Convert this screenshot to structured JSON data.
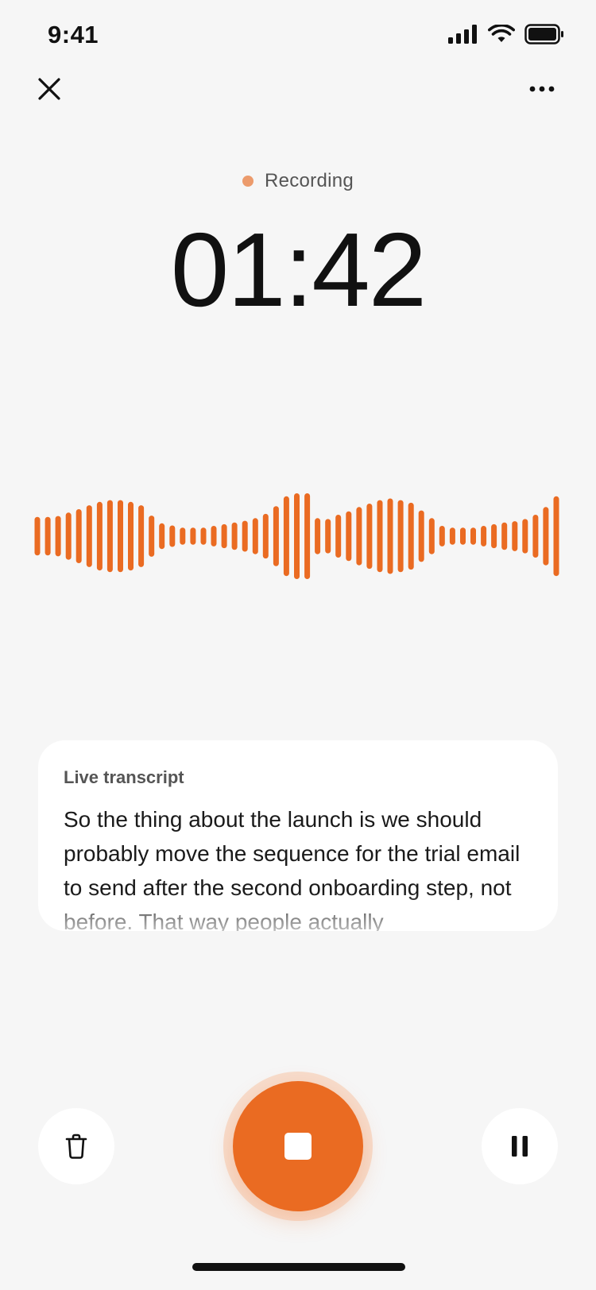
{
  "status_bar": {
    "time": "9:41"
  },
  "recording": {
    "status_label": "Recording",
    "elapsed": "01:42",
    "accent": "#ea6b22"
  },
  "waveform": {
    "levels": [
      0.45,
      0.45,
      0.47,
      0.55,
      0.63,
      0.72,
      0.8,
      0.84,
      0.84,
      0.8,
      0.72,
      0.48,
      0.3,
      0.25,
      0.2,
      0.2,
      0.2,
      0.24,
      0.28,
      0.32,
      0.36,
      0.42,
      0.52,
      0.7,
      0.93,
      1,
      1,
      0.42,
      0.4,
      0.5,
      0.58,
      0.68,
      0.76,
      0.84,
      0.88,
      0.84,
      0.78,
      0.6,
      0.42,
      0.24,
      0.2,
      0.2,
      0.2,
      0.24,
      0.28,
      0.32,
      0.35,
      0.4,
      0.5,
      0.68,
      0.93
    ]
  },
  "transcript": {
    "title": "Live transcript",
    "text": "So the thing about the launch is we should probably move the sequence for the trial email to send after the second onboarding step, not before. That way people actually"
  },
  "icons": {
    "close": "close-icon",
    "more": "more-icon",
    "delete": "trash-icon",
    "stop": "stop-icon",
    "pause": "pause-icon"
  }
}
